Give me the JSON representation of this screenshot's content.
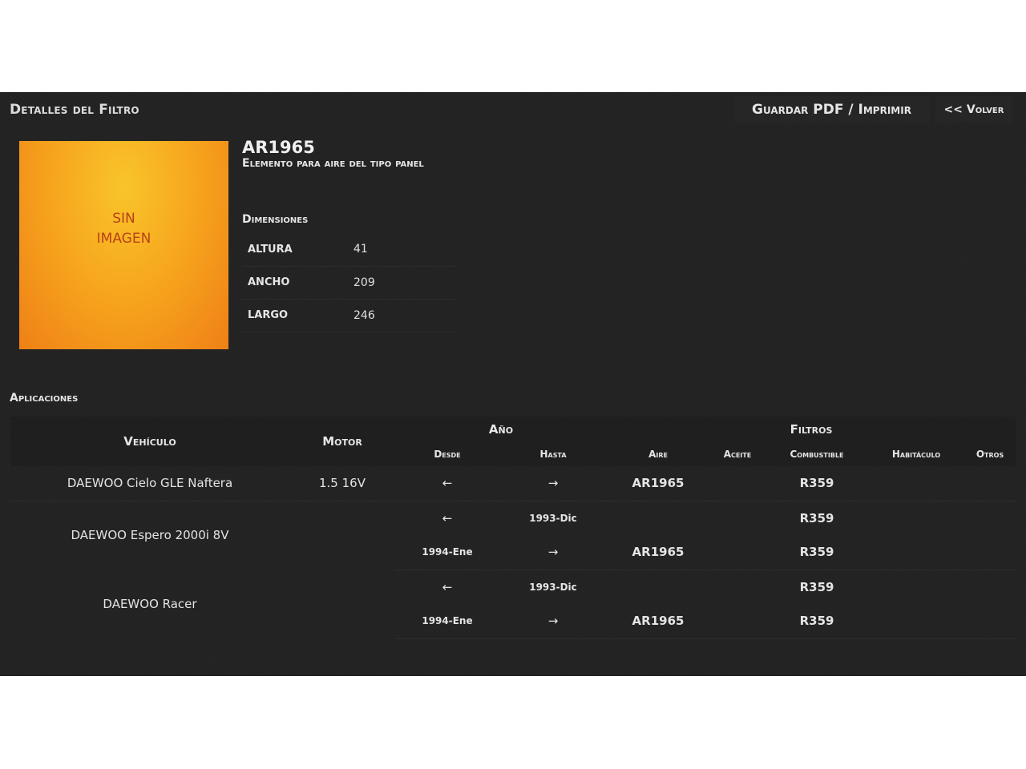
{
  "header": {
    "title": "Detalles del Filtro",
    "print_label": "Guardar PDF / Imprimir",
    "back_label": "<< Volver"
  },
  "image_placeholder": {
    "line1": "SIN",
    "line2": "IMAGEN"
  },
  "product": {
    "code": "AR1965",
    "description": "Elemento para aire del tipo panel"
  },
  "dimensions": {
    "title": "Dimensiones",
    "rows": [
      {
        "label": "ALTURA",
        "value": "41"
      },
      {
        "label": "ANCHO",
        "value": "209"
      },
      {
        "label": "LARGO",
        "value": "246"
      }
    ]
  },
  "applications": {
    "title": "Aplicaciones",
    "headers": {
      "vehicle": "Vehículo",
      "motor": "Motor",
      "year": "Año",
      "from": "Desde",
      "to": "Hasta",
      "filters": "Filtros",
      "air": "Aire",
      "oil": "Aceite",
      "fuel": "Combustible",
      "cabin": "Habitáculo",
      "other": "Otros"
    },
    "rows": [
      {
        "vehicle": "DAEWOO Cielo GLE Naftera",
        "motor": "1.5 16V",
        "from": "←",
        "to": "→",
        "air": "AR1965",
        "oil": "",
        "fuel": "R359",
        "cabin": "",
        "other": ""
      },
      {
        "vehicle": "DAEWOO Espero 2000i 8V",
        "motor": "",
        "from": "←",
        "to": "1993-Dic",
        "air": "",
        "oil": "",
        "fuel": "R359",
        "cabin": "",
        "other": ""
      },
      {
        "vehicle": "",
        "motor": "",
        "from": "1994-Ene",
        "to": "→",
        "air": "AR1965",
        "oil": "",
        "fuel": "R359",
        "cabin": "",
        "other": ""
      },
      {
        "vehicle": "DAEWOO Racer",
        "motor": "",
        "from": "←",
        "to": "1993-Dic",
        "air": "",
        "oil": "",
        "fuel": "R359",
        "cabin": "",
        "other": ""
      },
      {
        "vehicle": "",
        "motor": "",
        "from": "1994-Ene",
        "to": "→",
        "air": "AR1965",
        "oil": "",
        "fuel": "R359",
        "cabin": "",
        "other": ""
      }
    ]
  }
}
